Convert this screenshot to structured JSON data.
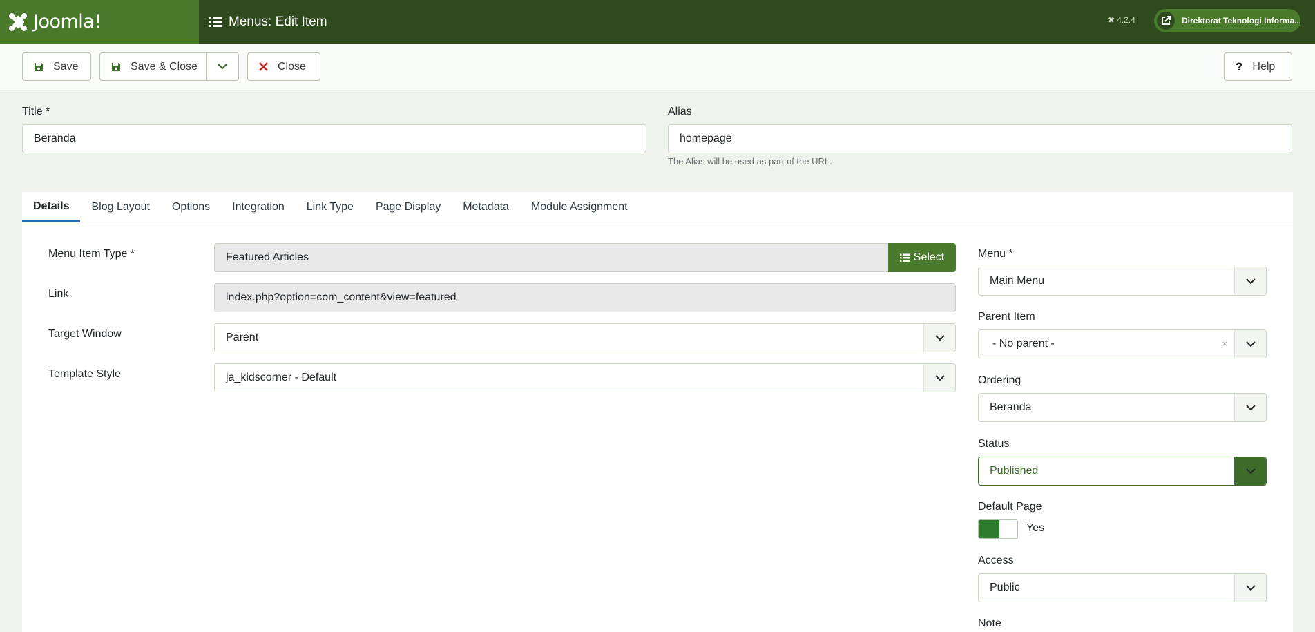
{
  "header": {
    "brand": "Joomla!",
    "title": "Menus: Edit Item",
    "version": "4.2.4",
    "site_name": "Direktorat Teknologi Informa..."
  },
  "toolbar": {
    "save": "Save",
    "save_close": "Save & Close",
    "close": "Close",
    "help": "Help"
  },
  "form": {
    "title_label": "Title *",
    "title_value": "Beranda",
    "alias_label": "Alias",
    "alias_value": "homepage",
    "alias_hint": "The Alias will be used as part of the URL."
  },
  "tabs": [
    "Details",
    "Blog Layout",
    "Options",
    "Integration",
    "Link Type",
    "Page Display",
    "Metadata",
    "Module Assignment"
  ],
  "details": {
    "menu_item_type_label": "Menu Item Type *",
    "menu_item_type_value": "Featured Articles",
    "select_label": "Select",
    "link_label": "Link",
    "link_value": "index.php?option=com_content&view=featured",
    "target_window_label": "Target Window",
    "target_window_value": "Parent",
    "template_style_label": "Template Style",
    "template_style_value": "ja_kidscorner - Default"
  },
  "sidebar": {
    "menu_label": "Menu *",
    "menu_value": "Main Menu",
    "parent_label": "Parent Item",
    "parent_value": "- No parent -",
    "ordering_label": "Ordering",
    "ordering_value": "Beranda",
    "status_label": "Status",
    "status_value": "Published",
    "default_page_label": "Default Page",
    "default_page_value": "Yes",
    "access_label": "Access",
    "access_value": "Public",
    "note_label": "Note"
  },
  "colors": {
    "header_bg": "#2f4a1c",
    "brand_green": "#4a7a2c",
    "status_green": "#3c6b2a",
    "tab_active": "#2a69b8",
    "close_red": "#c62828"
  },
  "icons": {
    "save": "floppy-disk-icon",
    "close": "x-icon",
    "help": "question-icon",
    "menu": "list-icon",
    "external": "external-link-icon",
    "dropdown": "chevron-down-icon"
  }
}
